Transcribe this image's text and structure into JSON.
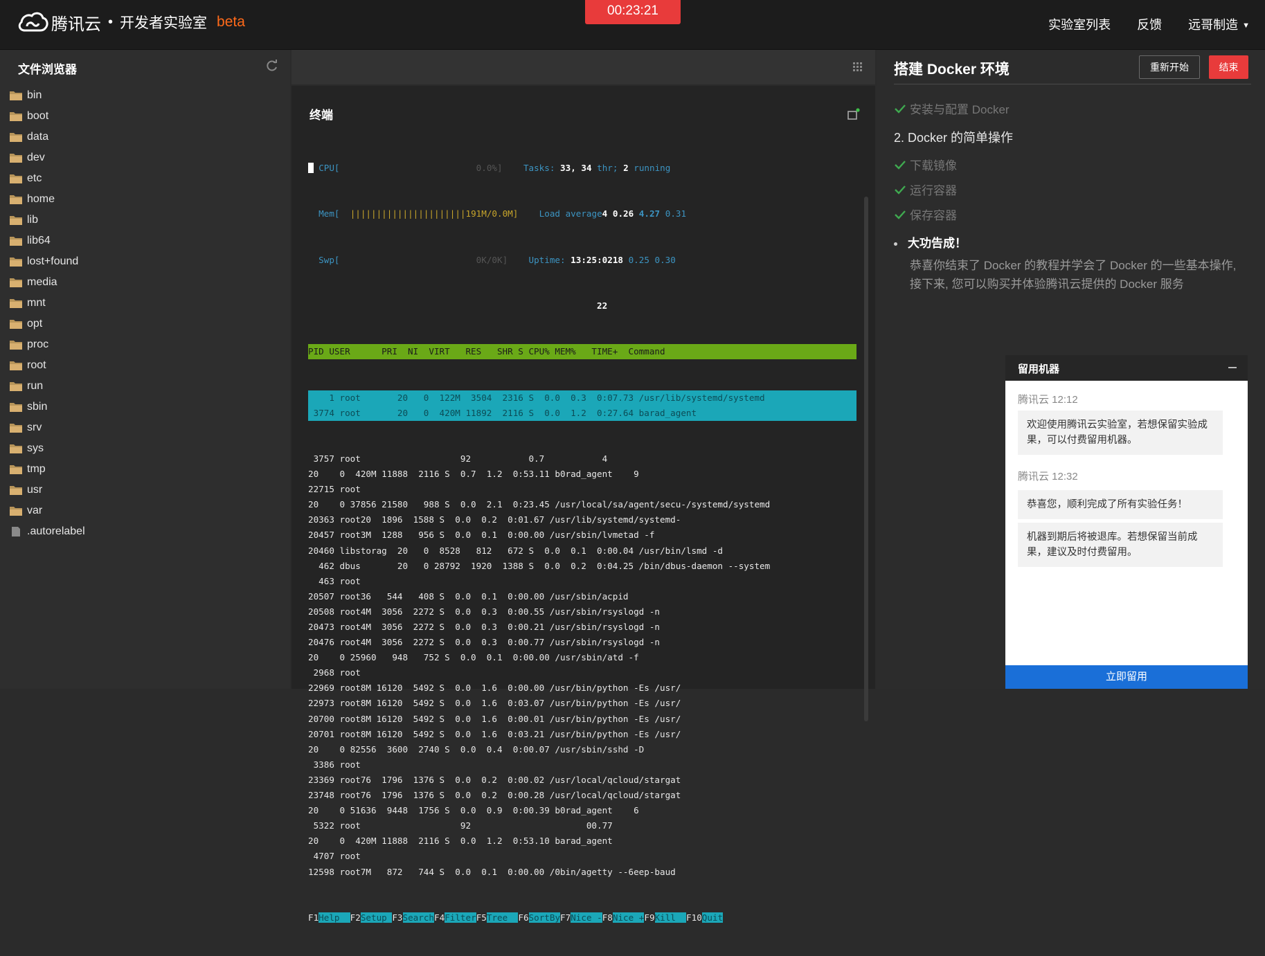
{
  "header": {
    "brand": "腾讯云",
    "separator": "•",
    "subbrand": "开发者实验室",
    "beta": "beta",
    "timer": "00:23:21",
    "nav": [
      "实验室列表",
      "反馈",
      "远哥制造"
    ]
  },
  "file_browser": {
    "title": "文件浏览器",
    "items": [
      {
        "name": "bin",
        "type": "folder"
      },
      {
        "name": "boot",
        "type": "folder"
      },
      {
        "name": "data",
        "type": "folder"
      },
      {
        "name": "dev",
        "type": "folder"
      },
      {
        "name": "etc",
        "type": "folder"
      },
      {
        "name": "home",
        "type": "folder"
      },
      {
        "name": "lib",
        "type": "folder"
      },
      {
        "name": "lib64",
        "type": "folder"
      },
      {
        "name": "lost+found",
        "type": "folder"
      },
      {
        "name": "media",
        "type": "folder"
      },
      {
        "name": "mnt",
        "type": "folder"
      },
      {
        "name": "opt",
        "type": "folder"
      },
      {
        "name": "proc",
        "type": "folder"
      },
      {
        "name": "root",
        "type": "folder"
      },
      {
        "name": "run",
        "type": "folder"
      },
      {
        "name": "sbin",
        "type": "folder"
      },
      {
        "name": "srv",
        "type": "folder"
      },
      {
        "name": "sys",
        "type": "folder"
      },
      {
        "name": "tmp",
        "type": "folder"
      },
      {
        "name": "usr",
        "type": "folder"
      },
      {
        "name": "var",
        "type": "folder"
      },
      {
        "name": ".autorelabel",
        "type": "file"
      }
    ]
  },
  "terminal": {
    "title": "终端",
    "meters": {
      "cpu_label": "CPU[",
      "cpu_value": "0.0%]",
      "mem_label": "Mem[",
      "mem_bar": "||||||||||||||||||||||",
      "mem_value": "191M/0.0M]",
      "swp_label": "Swp[",
      "swp_value": "0K/0K]",
      "tasks_label": "Tasks:",
      "tasks_a": "33,",
      "tasks_b": "34",
      "tasks_thr": "thr;",
      "tasks_run": "2",
      "tasks_running": "running",
      "load_label": "Load average",
      "load_a": "4",
      "load_b": "0.26",
      "load_c": "4.27",
      "load_d": "0.31",
      "uptime_label": "Uptime:",
      "uptime_value": "13:25:0218",
      "uptime_extra": "0.25 0.30",
      "extra_22": "22"
    },
    "header_row": "PID USER      PRI  NI  VIRT   RES   SHR S CPU% MEM%   TIME+  Command",
    "highlight_rows": [
      "    1 root       20   0  122M  3504  2316 S  0.0  0.3  0:07.73 /usr/lib/systemd/systemd",
      " 3774 root       20   0  420M 11892  2116 S  0.0  1.2  0:27.64 barad_agent"
    ],
    "rows": [
      " 3757 root                   92           0.7           4",
      "20    0  420M 11888  2116 S  0.7  1.2  0:53.11 b0rad_agent    9",
      "22715 root",
      "20    0 37856 21580   988 S  0.0  2.1  0:23.45 /usr/local/sa/agent/secu-/systemd/systemd",
      "20363 root20  1896  1588 S  0.0  0.2  0:01.67 /usr/lib/systemd/systemd-",
      "20457 root3M  1288   956 S  0.0  0.1  0:00.00 /usr/sbin/lvmetad -f",
      "20460 libstorag  20   0  8528   812   672 S  0.0  0.1  0:00.04 /usr/bin/lsmd -d",
      "  462 dbus       20   0 28792  1920  1388 S  0.0  0.2  0:04.25 /bin/dbus-daemon --system",
      "  463 root",
      "20507 root36   544   408 S  0.0  0.1  0:00.00 /usr/sbin/acpid",
      "20508 root4M  3056  2272 S  0.0  0.3  0:00.55 /usr/sbin/rsyslogd -n",
      "20473 root4M  3056  2272 S  0.0  0.3  0:00.21 /usr/sbin/rsyslogd -n",
      "20476 root4M  3056  2272 S  0.0  0.3  0:00.77 /usr/sbin/rsyslogd -n",
      "20    0 25960   948   752 S  0.0  0.1  0:00.00 /usr/sbin/atd -f",
      " 2968 root",
      "22969 root8M 16120  5492 S  0.0  1.6  0:00.00 /usr/bin/python -Es /usr/",
      "22973 root8M 16120  5492 S  0.0  1.6  0:03.07 /usr/bin/python -Es /usr/",
      "20700 root8M 16120  5492 S  0.0  1.6  0:00.01 /usr/bin/python -Es /usr/",
      "20701 root8M 16120  5492 S  0.0  1.6  0:03.21 /usr/bin/python -Es /usr/",
      "20    0 82556  3600  2740 S  0.0  0.4  0:00.07 /usr/sbin/sshd -D",
      " 3386 root",
      "23369 root76  1796  1376 S  0.0  0.2  0:00.02 /usr/local/qcloud/stargat",
      "23748 root76  1796  1376 S  0.0  0.2  0:00.28 /usr/local/qcloud/stargat",
      "20    0 51636  9448  1756 S  0.0  0.9  0:00.39 b0rad_agent    6",
      " 5322 root                   92                      00.77",
      "20    0  420M 11888  2116 S  0.0  1.2  0:53.10 barad_agent",
      " 4707 root",
      "12598 root7M   872   744 S  0.0  0.1  0:00.00 /0bin/agetty --6eep-baud"
    ],
    "fkeys": [
      {
        "k": "F1",
        "l": "Help  "
      },
      {
        "k": "F2",
        "l": "Setup "
      },
      {
        "k": "F3",
        "l": "Search"
      },
      {
        "k": "F4",
        "l": "Filter"
      },
      {
        "k": "F5",
        "l": "Tree  "
      },
      {
        "k": "F6",
        "l": "SortBy"
      },
      {
        "k": "F7",
        "l": "Nice -"
      },
      {
        "k": "F8",
        "l": "Nice +"
      },
      {
        "k": "F9",
        "l": "Kill  "
      },
      {
        "k": "F10",
        "l": "Quit"
      }
    ]
  },
  "guide": {
    "title": "搭建 Docker 环境",
    "restart": "重新开始",
    "end": "结束",
    "step_prev": "安装与配置 Docker",
    "section": "2. Docker 的简单操作",
    "steps": [
      "下载镜像",
      "运行容器",
      "保存容器"
    ],
    "bullet": "大功告成！",
    "congrats": "恭喜你结束了 Docker 的教程并学会了 Docker 的一些基本操作, 接下来, 您可以购买并体验腾讯云提供的 Docker 服务"
  },
  "keep_panel": {
    "title": "留用机器",
    "messages": [
      {
        "meta": "腾讯云 12:12",
        "text": "欢迎使用腾讯云实验室，若想保留实验成果，可以付费留用机器。"
      },
      {
        "meta": "腾讯云 12:32",
        "text": "恭喜您，顺利完成了所有实验任务！"
      },
      {
        "meta": "",
        "text": "机器到期后将被退库。若想保留当前成果，建议及时付费留用。"
      }
    ],
    "button": "立即留用"
  },
  "colors": {
    "accent_red": "#e83b3b",
    "beta_orange": "#ff6a1a",
    "htop_green": "#6aa917",
    "htop_cyan": "#1ba7b8",
    "link_blue": "#1a6fd8"
  }
}
